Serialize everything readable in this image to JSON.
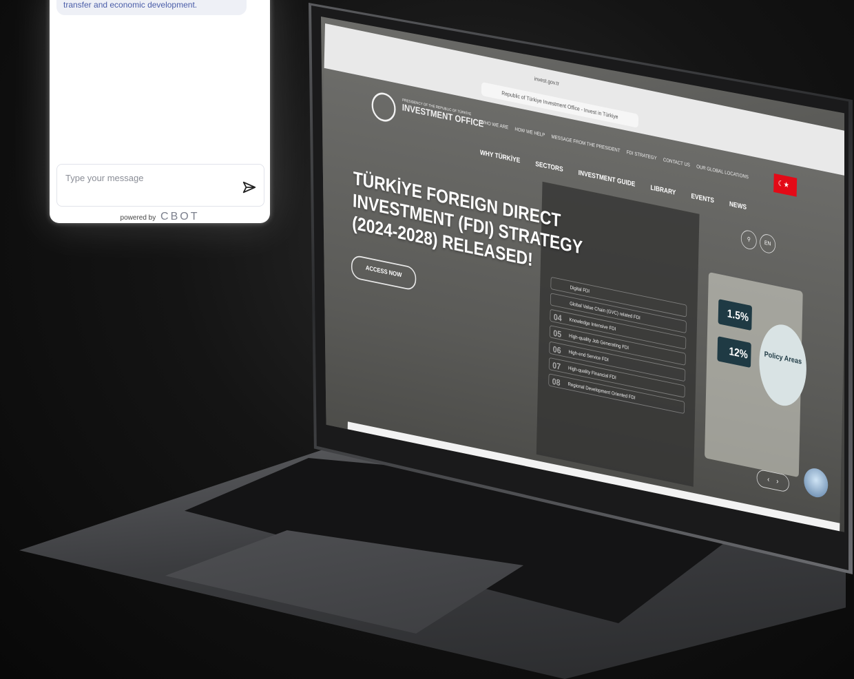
{
  "chat_widget": {
    "bubble_text": "transfer and economic development.",
    "input_placeholder": "Type your message",
    "powered_by": "powered by",
    "brand": "CBOT"
  },
  "browser": {
    "url_host": "invest.gov.tr",
    "tab_title": "Republic of Türkiye Investment Office - Invest in Türkiye"
  },
  "site": {
    "logo_small": "PRESIDENCY OF THE REPUBLIC OF TÜRKİYE",
    "logo_main": "INVESTMENT OFFICE",
    "top_nav": [
      "WHO WE ARE",
      "HOW WE HELP",
      "MESSAGE FROM THE PRESIDENT",
      "FDI STRATEGY",
      "CONTACT US",
      "OUR GLOBAL LOCATIONS"
    ],
    "main_nav": [
      "WHY TÜRKİYE",
      "SECTORS",
      "INVESTMENT GUIDE",
      "LIBRARY",
      "EVENTS",
      "NEWS"
    ],
    "lang": "EN",
    "headline": "TÜRKİYE FOREIGN DIRECT INVESTMENT (FDI) STRATEGY (2024-2028) RELEASED!",
    "access_button": "ACCESS NOW",
    "fdi_items": [
      {
        "num": "",
        "label": "Digital FDI"
      },
      {
        "num": "",
        "label": "Global Value Chain (GVC) related FDI"
      },
      {
        "num": "04",
        "label": "Knowledge Intensive FDI"
      },
      {
        "num": "05",
        "label": "High-quality Job Generating FDI"
      },
      {
        "num": "06",
        "label": "High-end Service FDI"
      },
      {
        "num": "07",
        "label": "High-quality Financial FDI"
      },
      {
        "num": "08",
        "label": "Regional Development Oriented FDI"
      }
    ],
    "goal_values": [
      "1.5%",
      "12%"
    ],
    "policy_label": "Policy Areas",
    "slider_prev": "‹",
    "slider_next": "›"
  }
}
